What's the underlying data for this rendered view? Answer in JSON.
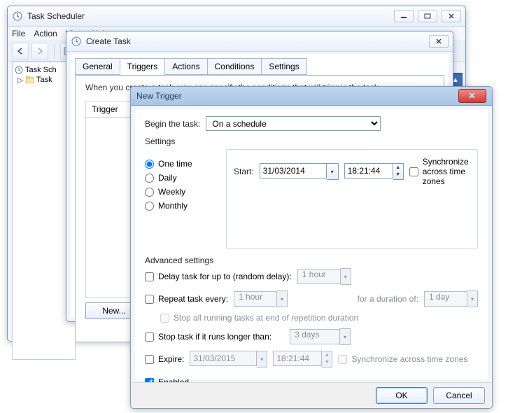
{
  "mainWindow": {
    "title": "Task Scheduler",
    "menu": {
      "file": "File",
      "action": "Action",
      "view": "View",
      "help": "Help"
    },
    "tree": {
      "root": "Task Sch",
      "child": "Task"
    }
  },
  "createTask": {
    "title": "Create Task",
    "tabs": {
      "general": "General",
      "triggers": "Triggers",
      "actions": "Actions",
      "conditions": "Conditions",
      "settings": "Settings"
    },
    "desc": "When you create a task, you can specify the conditions that will trigger the task.",
    "col_trigger": "Trigger",
    "btn_new": "New..."
  },
  "newTrigger": {
    "title": "New Trigger",
    "begin_label": "Begin the task:",
    "begin_value": "On a schedule",
    "settings_label": "Settings",
    "schedule_options": {
      "onetime": "One time",
      "daily": "Daily",
      "weekly": "Weekly",
      "monthly": "Monthly"
    },
    "start_label": "Start:",
    "start_date": "31/03/2014",
    "start_time": "18:21:44",
    "sync_tz": "Synchronize across time zones",
    "advanced_label": "Advanced settings",
    "delay_label": "Delay task for up to (random delay):",
    "delay_value": "1 hour",
    "repeat_label": "Repeat task every:",
    "repeat_value": "1 hour",
    "duration_label": "for a duration of:",
    "duration_value": "1 day",
    "stop_end_label": "Stop all running tasks at end of repetition duration",
    "stop_longer_label": "Stop task if it runs longer than:",
    "stop_longer_value": "3 days",
    "expire_label": "Expire:",
    "expire_date": "31/03/2015",
    "expire_time": "18:21:44",
    "expire_sync": "Synchronize across time zones",
    "enabled_label": "Enabled",
    "ok": "OK",
    "cancel": "Cancel"
  }
}
